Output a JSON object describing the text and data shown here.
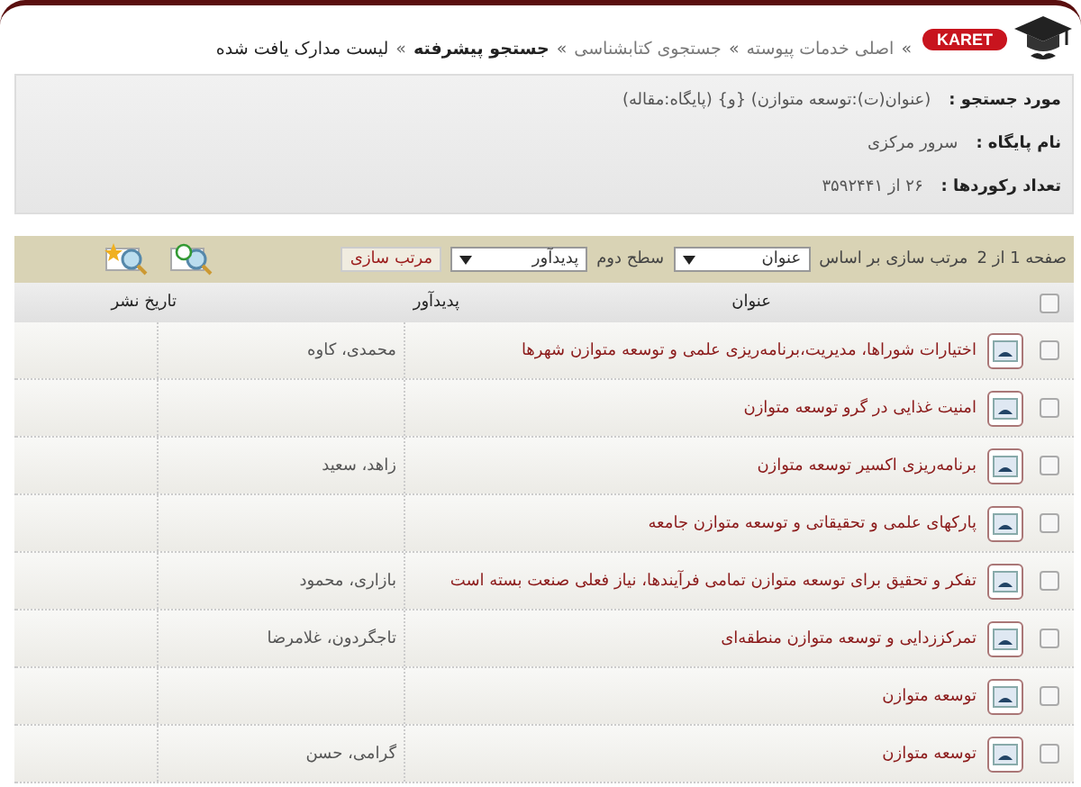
{
  "logo": {
    "text": "KARET"
  },
  "breadcrumb": {
    "separator": "»",
    "items": [
      {
        "label": "اصلی خدمات پیوسته",
        "kind": "link"
      },
      {
        "label": "جستجوی کتابشناسی",
        "kind": "link"
      },
      {
        "label": "جستجو پیشرفته",
        "kind": "current"
      },
      {
        "label": "لیست مدارک یافت شده",
        "kind": "page"
      }
    ]
  },
  "info": [
    {
      "label": "مورد جستجو :",
      "value": "(عنوان(ت):توسعه متوازن) {و} (پایگاه:مقاله)"
    },
    {
      "label": "نام پایگاه :",
      "value": "سرور مرکزی"
    },
    {
      "label": "تعداد رکوردها :",
      "value": "۲۶ از ۳۵۹۲۴۴۱"
    }
  ],
  "toolbar": {
    "page": "صفحه 1 از 2",
    "sort_label": "مرتب سازی بر اساس",
    "sort_first": "عنوان",
    "second_label": "سطح دوم",
    "sort_second": "پدیدآور",
    "sort_button": "مرتب سازی"
  },
  "table": {
    "header_checked": false,
    "columns": [
      "عنوان",
      "پدیدآور",
      "تاریخ نشر"
    ],
    "rows": [
      {
        "checked": false,
        "title": "اختیارات شوراها، مدیریت،برنامه‌ریزی علمی و توسعه متوازن شهرها",
        "author": "محمدی، کاوه"
      },
      {
        "checked": false,
        "title": "امنیت غذایی در گرو توسعه متوازن"
      },
      {
        "checked": false,
        "title": "برنامه‌ریزی اکسیر توسعه متوازن",
        "author": "زاهد، سعید"
      },
      {
        "checked": false,
        "title": "پارکهای علمی و تحقیقاتی و توسعه متوازن جامعه"
      },
      {
        "checked": false,
        "title": "تفکر و تحقیق برای توسعه متوازن تمامی فرآیندها، نیاز فعلی صنعت بسته است",
        "author": "بازاری، محمود"
      },
      {
        "checked": false,
        "title": "تمرکززدایی و توسعه متوازن منطقه‌ای",
        "author": "تاجگردون، غلامرضا"
      },
      {
        "checked": false,
        "title": "توسعه متوازن"
      },
      {
        "checked": false,
        "title": "توسعه متوازن",
        "author": "گرامی، حسن"
      }
    ]
  }
}
